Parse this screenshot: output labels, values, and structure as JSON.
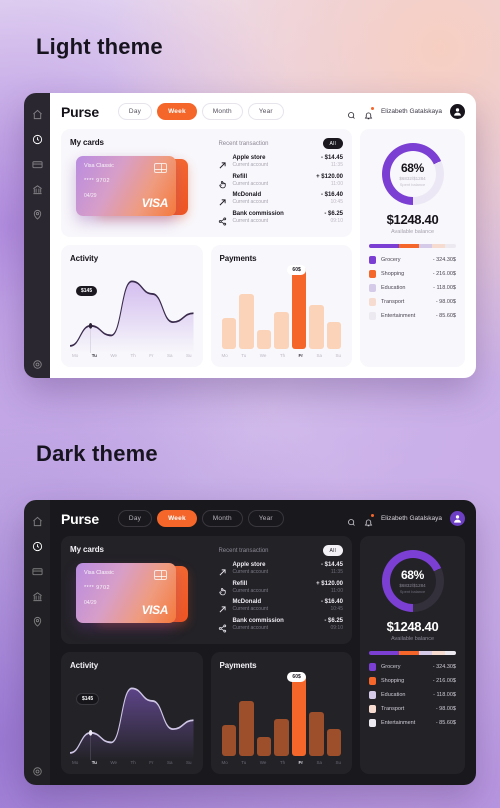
{
  "sections": {
    "light_title": "Light theme",
    "dark_title": "Dark theme"
  },
  "brand": "Purse",
  "segments": [
    {
      "label": "Day",
      "active": false
    },
    {
      "label": "Week",
      "active": true
    },
    {
      "label": "Month",
      "active": false
    },
    {
      "label": "Year",
      "active": false
    }
  ],
  "header": {
    "search_icon": "search-icon",
    "bell_icon": "bell-icon",
    "user_name": "Elizabeth Gatalskaya",
    "avatar_icon": "avatar"
  },
  "sidebar": {
    "items": [
      {
        "icon": "home-icon",
        "active": false
      },
      {
        "icon": "clock-icon",
        "active": true
      },
      {
        "icon": "card-icon",
        "active": false
      },
      {
        "icon": "bank-icon",
        "active": false
      },
      {
        "icon": "location-icon",
        "active": false
      }
    ],
    "bottom": {
      "icon": "gear-icon"
    }
  },
  "my_cards": {
    "title": "My cards",
    "card": {
      "name": "Visa Classic",
      "number": "**** 9702",
      "expiry": "04/29",
      "brand": "VISA"
    }
  },
  "recent": {
    "title": "Recent transaction",
    "pill": "All",
    "items": [
      {
        "icon": "arrow-out-icon",
        "name": "Apple store",
        "sub": "Current account",
        "amount": "- $14.45",
        "time": "11:35"
      },
      {
        "icon": "hand-tap-icon",
        "name": "Refill",
        "sub": "Current account",
        "amount": "+ $120.00",
        "time": "11:00"
      },
      {
        "icon": "arrow-out-icon",
        "name": "McDonald",
        "sub": "Current account",
        "amount": "- $16.40",
        "time": "10:45"
      },
      {
        "icon": "share-icon",
        "name": "Bank commission",
        "sub": "Current account",
        "amount": "- $6.25",
        "time": "09:10"
      }
    ]
  },
  "activity": {
    "title": "Activity",
    "tooltip": "$145",
    "days": [
      "Mo",
      "Tu",
      "We",
      "Th",
      "Fr",
      "Sa",
      "Su"
    ],
    "active_day": "Tu"
  },
  "payments": {
    "title": "Payments",
    "tooltip": "60$",
    "days": [
      "Mo",
      "Tu",
      "We",
      "Th",
      "Fr",
      "Sa",
      "Su"
    ],
    "active_day": "Fr"
  },
  "balance": {
    "percent": "68%",
    "spent_ratio": "$6832/$1284",
    "spent_label": "Spent balance",
    "amount": "$1248.40",
    "label": "Available balance"
  },
  "categories": [
    {
      "name": "Grocery",
      "value": "- 324.30$",
      "color": "#7b3fd4",
      "width": 34
    },
    {
      "name": "Shopping",
      "value": "- 216.00$",
      "color": "#f4662a",
      "width": 23
    },
    {
      "name": "Education",
      "value": "- 118.00$",
      "color": "#d5cbe8",
      "width": 16
    },
    {
      "name": "Transport",
      "value": "- 98.00$",
      "color": "#f6dcd0",
      "width": 14
    },
    {
      "name": "Entertainment",
      "value": "- 85.60$",
      "color": "#ece9f1",
      "width": 13
    }
  ],
  "chart_data": [
    {
      "type": "area",
      "title": "Activity",
      "categories": [
        "Mo",
        "Tu",
        "We",
        "Th",
        "Fr",
        "Sa",
        "Su"
      ],
      "values": [
        118,
        145,
        132,
        205,
        188,
        150,
        162
      ],
      "xlabel": "",
      "ylabel": "",
      "annotation": "$145",
      "annotation_index": 1,
      "grid": false,
      "legend": "none"
    },
    {
      "type": "bar",
      "title": "Payments",
      "categories": [
        "Mo",
        "Tu",
        "We",
        "Th",
        "Fr",
        "Sa",
        "Su"
      ],
      "values": [
        30,
        52,
        18,
        35,
        78,
        42,
        26
      ],
      "xlabel": "",
      "ylabel": "",
      "annotation": "60$",
      "highlight_index": 4,
      "grid": false,
      "legend": "none"
    },
    {
      "type": "pie",
      "title": "Spent balance",
      "labels": [
        "Spent",
        "Remaining"
      ],
      "values": [
        68,
        32
      ],
      "center_label": "68%",
      "colors": [
        "#7b3fd4",
        "#ece7f4"
      ]
    }
  ]
}
